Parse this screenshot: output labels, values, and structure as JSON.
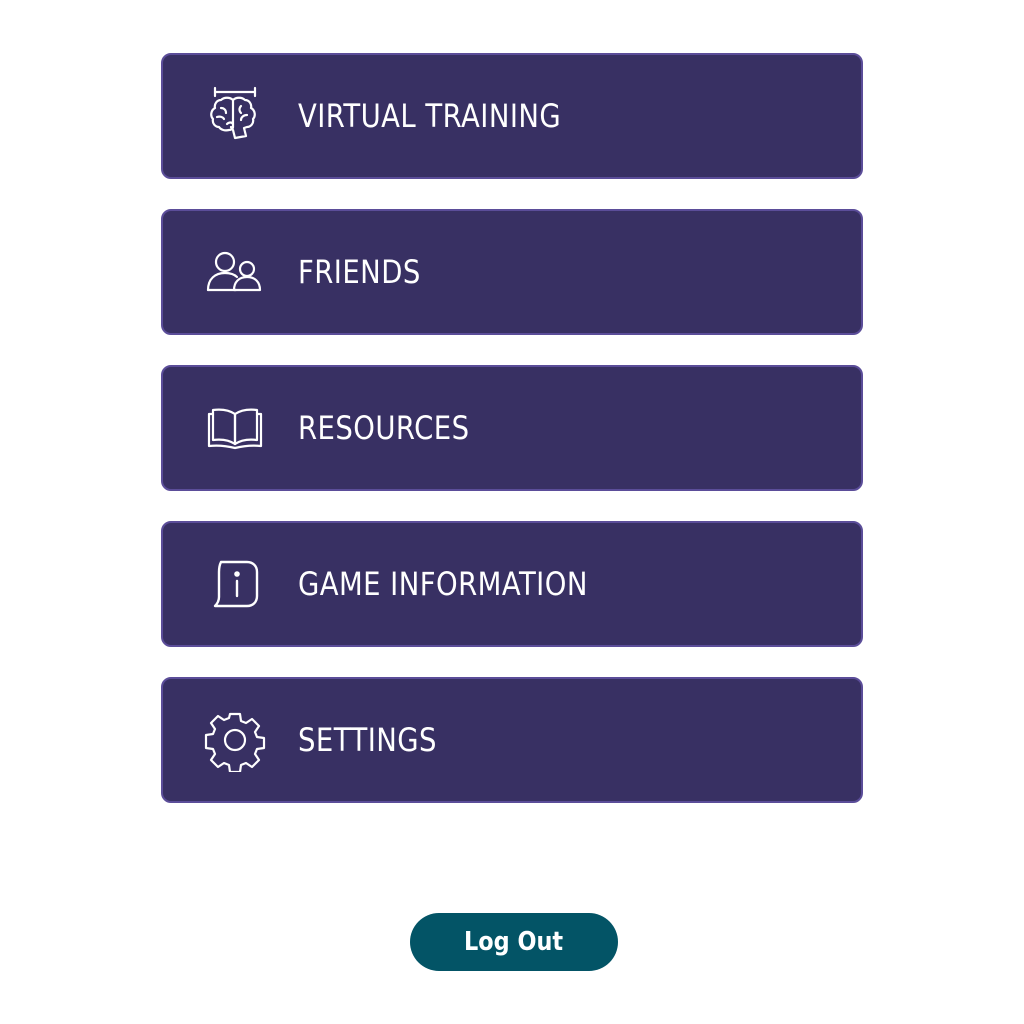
{
  "menu": {
    "items": [
      {
        "label": "VIRTUAL TRAINING",
        "icon": "brain-icon"
      },
      {
        "label": "FRIENDS",
        "icon": "friends-icon"
      },
      {
        "label": "RESOURCES",
        "icon": "book-icon"
      },
      {
        "label": "GAME INFORMATION",
        "icon": "info-icon"
      },
      {
        "label": "SETTINGS",
        "icon": "gear-icon"
      }
    ]
  },
  "logout": {
    "label": "Log Out"
  },
  "colors": {
    "menu_background": "#383063",
    "menu_border": "#5b4d99",
    "logout_background": "#035466",
    "text": "#ffffff",
    "page_background": "#ffffff"
  }
}
